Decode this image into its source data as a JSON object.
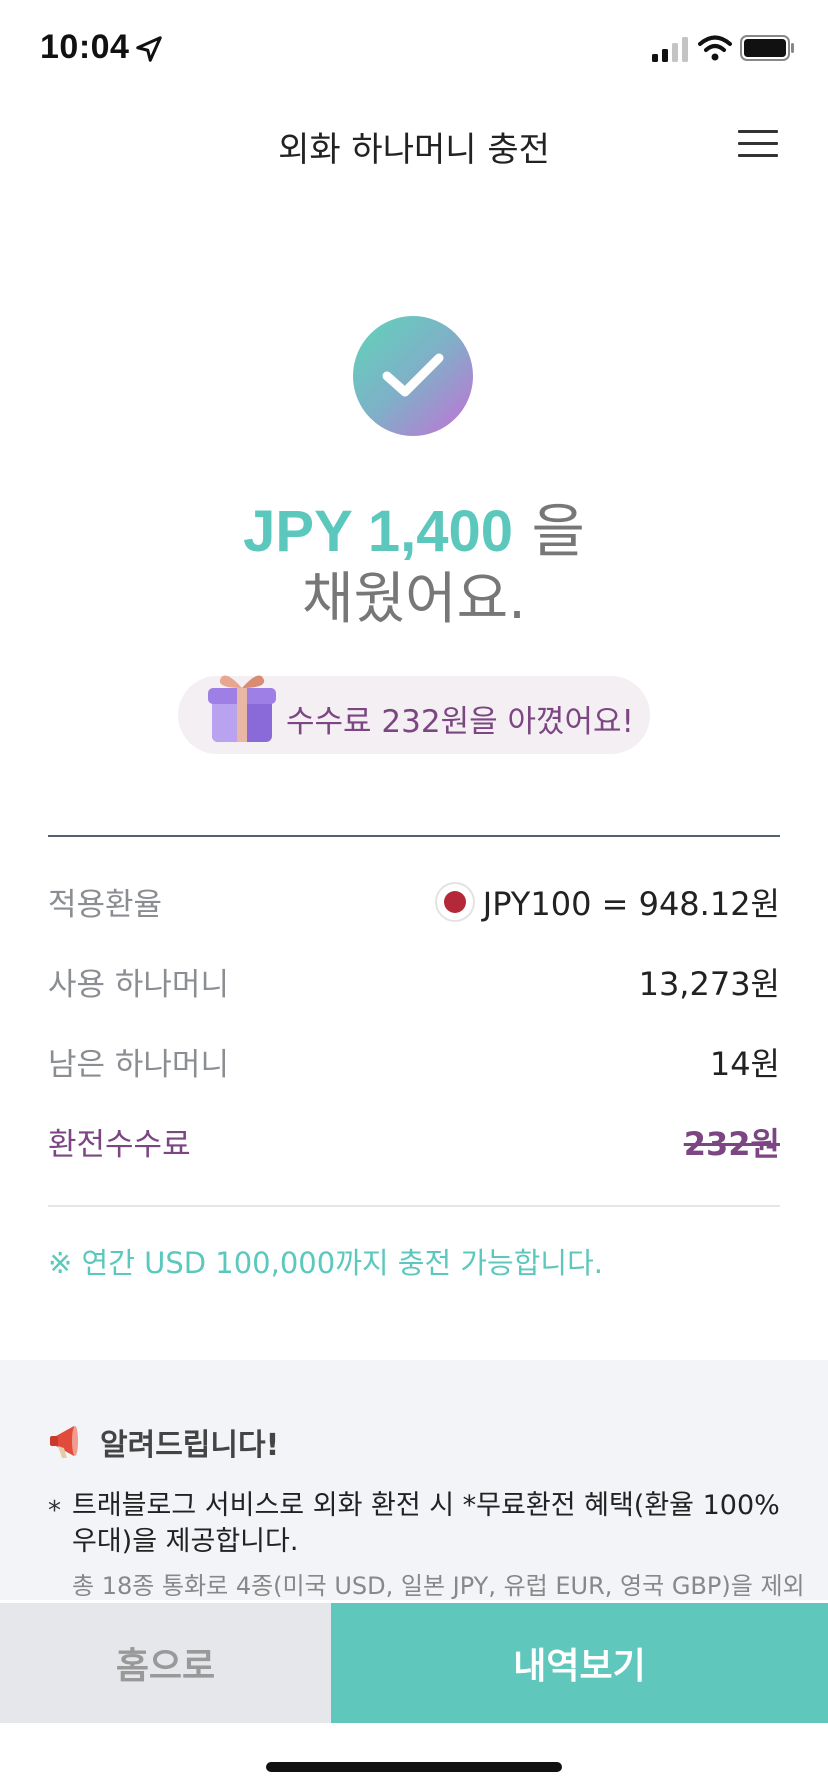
{
  "status_bar": {
    "time": "10:04"
  },
  "header": {
    "title": "외화 하나머니 충전"
  },
  "result": {
    "amount": "JPY 1,400",
    "suffix": " 을",
    "line2": "채웠어요."
  },
  "savings": {
    "text": "수수료 232원을 아꼈어요!"
  },
  "details": {
    "rate_label": "적용환율",
    "rate_value": "JPY100 = 948.12원",
    "used_label": "사용 하나머니",
    "used_value": "13,273원",
    "remaining_label": "남은 하나머니",
    "remaining_value": "14원",
    "fee_label": "환전수수료",
    "fee_value": "232원"
  },
  "limit_note": "※ 연간 USD 100,000까지 충전 가능합니다.",
  "notice": {
    "title": "알려드립니다!",
    "bullet": "*",
    "text": "트래블로그 서비스로 외화 환전 시 *무료환전 혜택(환율 100% 우대)을 제공합니다.",
    "sub": "총 18종 통화로 4종(미국 USD, 일본 JPY, 유럽 EUR, 영국 GBP)을 제외"
  },
  "buttons": {
    "home": "홈으로",
    "history": "내역보기"
  },
  "colors": {
    "accent": "#5fc7bc",
    "fee_purple": "#7b4682",
    "notice_bg": "#f2f4f7"
  },
  "icons": {
    "location": "location-arrow-icon",
    "signal": "signal-icon",
    "wifi": "wifi-icon",
    "battery": "battery-icon",
    "menu": "hamburger-menu-icon",
    "check": "check-circle-icon",
    "gift": "gift-icon",
    "flag": "japan-flag-icon",
    "megaphone": "megaphone-icon"
  }
}
